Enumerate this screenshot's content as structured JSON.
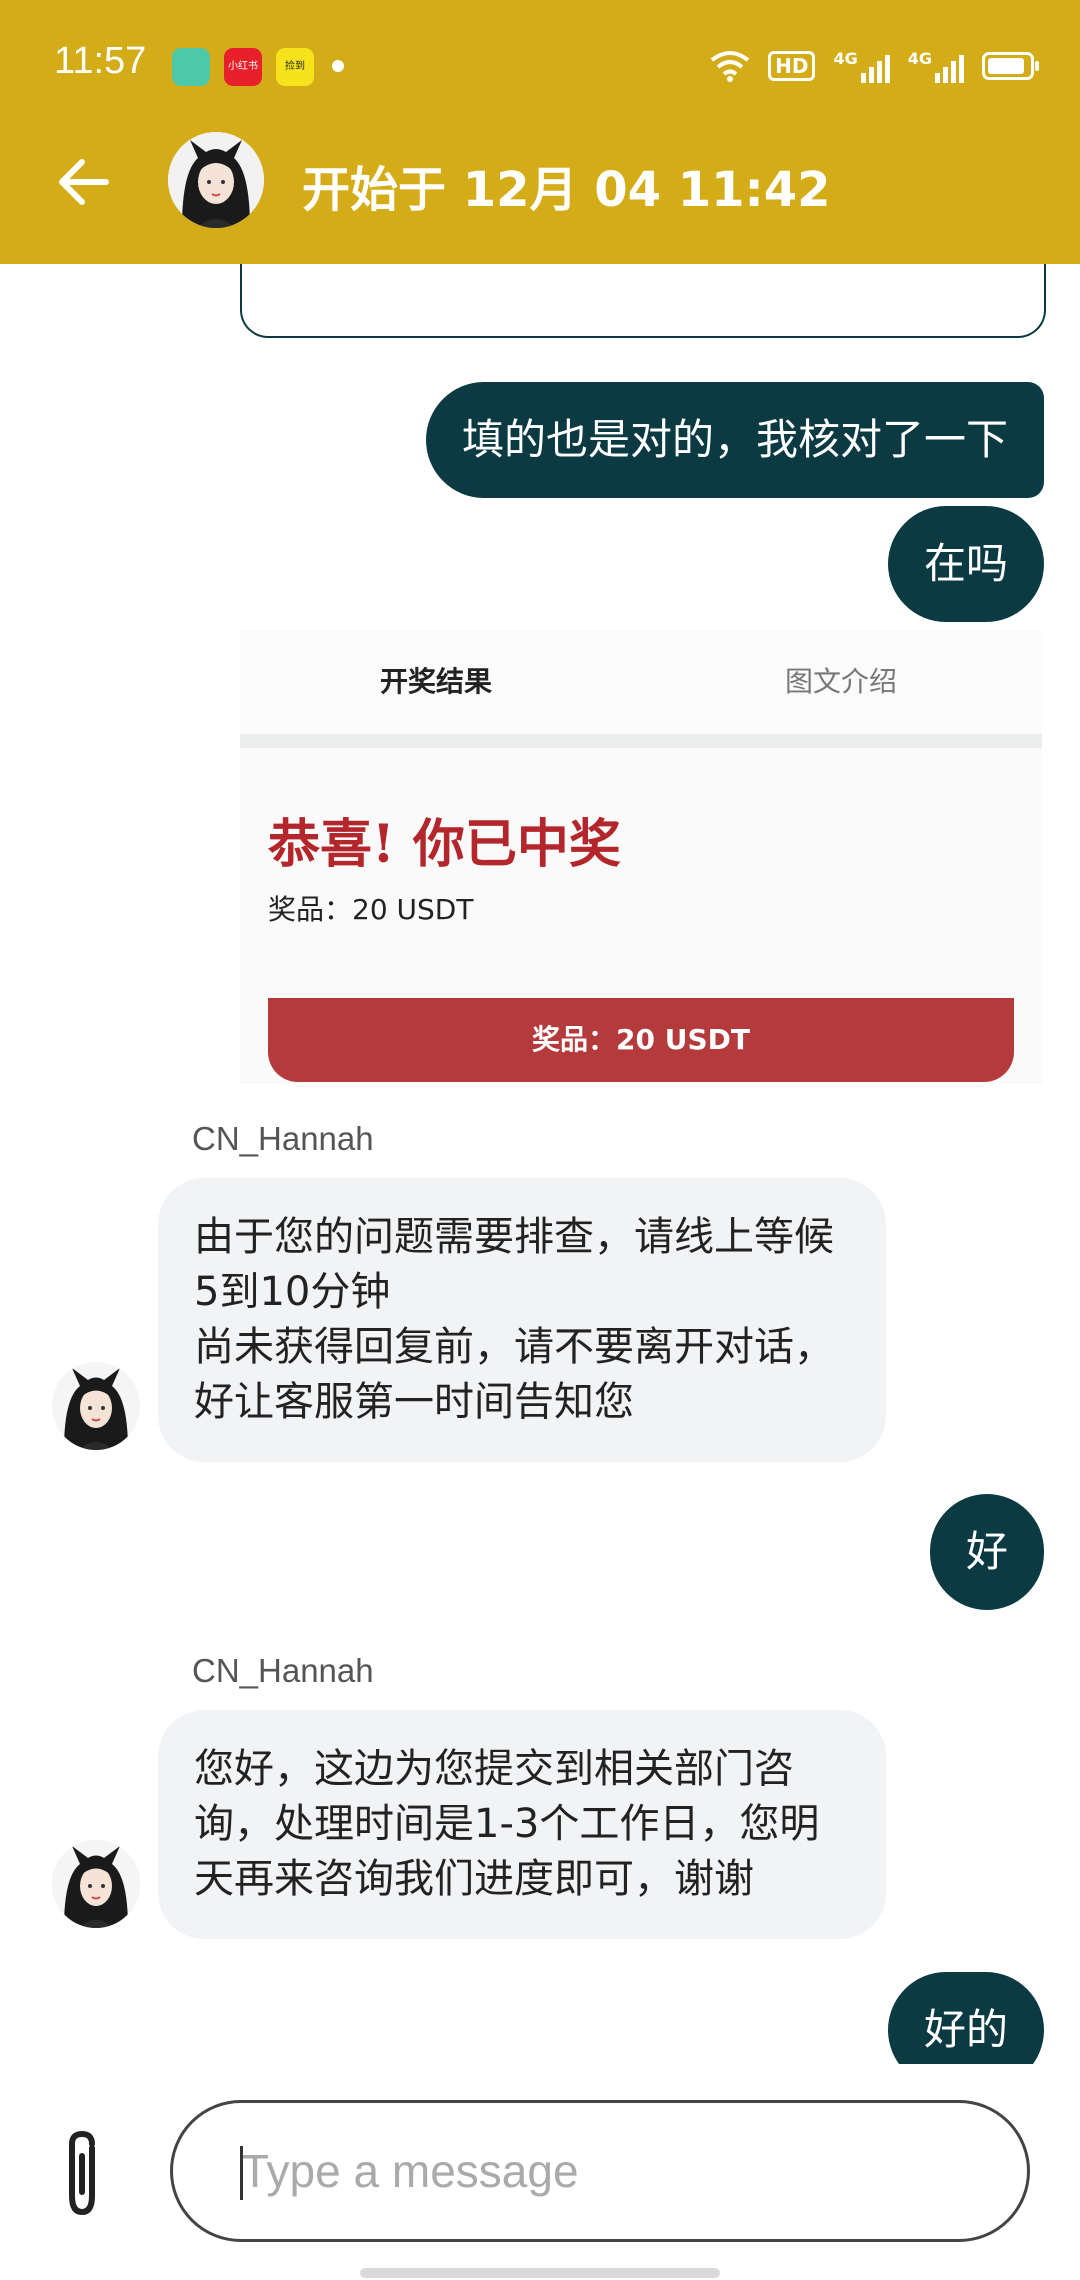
{
  "status_bar": {
    "time": "11:57",
    "app_icons": [
      "phone-icon",
      "xiaohongshu-icon",
      "app-yellow-icon"
    ],
    "red_icon_text": "小红书",
    "yellow_icon_text": "捡到",
    "network_labels": [
      "HD",
      "4G",
      "4G"
    ],
    "battery_level": 0.9
  },
  "header": {
    "title": "开始于 12月 04 11:42",
    "back_icon": "arrow-left-icon",
    "accent_color": "#d4ac17"
  },
  "messages": {
    "out_1": "填的也是对的，我核对了一下",
    "out_2": "在吗",
    "image_card": {
      "tab_active": "开奖结果",
      "tab_inactive": "图文介绍",
      "congrats": "恭喜! 你已中奖",
      "prize_text": "奖品：20 USDT",
      "button_text": "奖品：20 USDT"
    },
    "in_1": {
      "sender": "CN_Hannah",
      "line1": "由于您的问题需要排查，请线上等候5到10分钟",
      "line2": "尚未获得回复前，请不要离开对话，好让客服第一时间告知您"
    },
    "out_3": "好",
    "in_2": {
      "sender": "CN_Hannah",
      "line1": "您好，这边为您提交到相关部门咨询，处理时间是1-3个工作日，您明天再来咨询我们进度即可，谢谢"
    },
    "out_4": "好的",
    "bubble_out_color": "#0b3a42",
    "bubble_in_color": "#f2f3f5"
  },
  "composer": {
    "placeholder": "Type a message",
    "attach_icon": "paperclip-icon"
  }
}
